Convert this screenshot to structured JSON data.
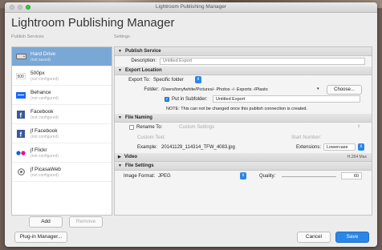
{
  "window": {
    "title": "Lightroom Publishing Manager"
  },
  "heading": "Lightroom Publishing Manager",
  "labels": {
    "publish_services": "Publish Services",
    "settings": "Settings"
  },
  "services": [
    {
      "name": "Hard Drive",
      "status": "(not saved)",
      "selected": true,
      "icon": "hard-drive-icon"
    },
    {
      "name": "500px",
      "status": "(not configured)",
      "icon": "500px-icon"
    },
    {
      "name": "Behance",
      "status": "(not configured)",
      "icon": "behance-icon"
    },
    {
      "name": "Facebook",
      "status": "(not configured)",
      "icon": "facebook-icon"
    },
    {
      "name": "jf Facebook",
      "status": "(not configured)",
      "icon": "jf-facebook-icon"
    },
    {
      "name": "jf Flickr",
      "status": "(not configured)",
      "icon": "flickr-icon"
    },
    {
      "name": "jf PicasaWeb",
      "status": "(not configured)",
      "icon": "picasaweb-icon"
    }
  ],
  "sidebar_buttons": {
    "add": "Add",
    "remove": "Remove"
  },
  "sections": {
    "publish_service": {
      "title": "Publish Service",
      "description_label": "Description:",
      "description_placeholder": "Untitled Export"
    },
    "export_location": {
      "title": "Export Location",
      "export_to_label": "Export To:",
      "export_to_value": "Specific folder",
      "folder_label": "Folder:",
      "folder_value": "/Users/tonyfwhite/Pictures/- Photos -/- Exports -/Plasto",
      "choose_button": "Choose...",
      "subfolder_label": "Put in Subfolder:",
      "subfolder_checked": true,
      "subfolder_value": "Untitled Export",
      "note": "NOTE: This can not be changed once this publish connection is created."
    },
    "file_naming": {
      "title": "File Naming",
      "rename_label": "Rename To:",
      "rename_checked": false,
      "rename_value": "Custom Settings",
      "custom_text_label": "Custom Text:",
      "start_number_label": "Start Number:",
      "example_label": "Example:",
      "example_value": "20141129_114314_TFW_4083.jpg",
      "extensions_label": "Extensions:",
      "extensions_value": "Lowercase"
    },
    "video": {
      "title": "Video",
      "right_text": "H.264 Max"
    },
    "file_settings": {
      "title": "File Settings",
      "image_format_label": "Image Format:",
      "image_format_value": "JPEG",
      "quality_label": "Quality:",
      "quality_value": "60"
    }
  },
  "footer": {
    "plugin_manager": "Plug-in Manager...",
    "cancel": "Cancel",
    "save": "Save"
  },
  "colors": {
    "accent": "#2a86e8",
    "selection": "#7aa8d6"
  }
}
